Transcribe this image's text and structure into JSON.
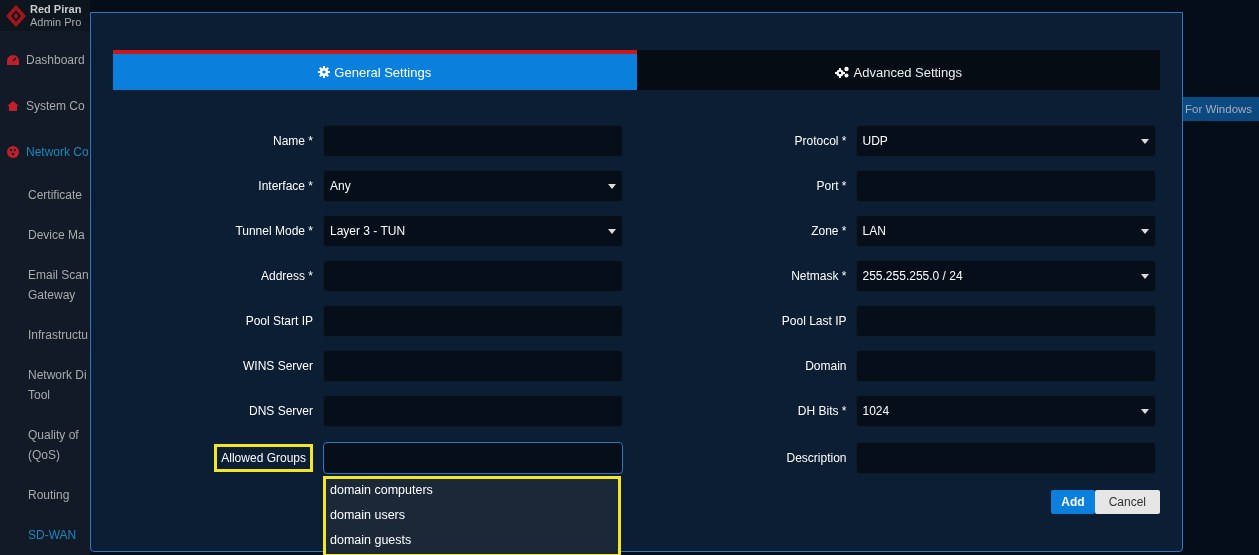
{
  "sidebar": {
    "brand": {
      "name": "Red Piran",
      "profile": "Admin Pro"
    },
    "items": [
      {
        "kind": "icon",
        "lines": [
          "Dashboard"
        ],
        "active": false
      },
      {
        "kind": "icon",
        "lines": [
          "System Co"
        ],
        "active": false
      },
      {
        "kind": "icon",
        "lines": [
          "Network Co"
        ],
        "active": true
      },
      {
        "kind": "sub",
        "lines": [
          "Certificate"
        ],
        "active": false
      },
      {
        "kind": "sub",
        "lines": [
          "Device Ma"
        ],
        "active": false
      },
      {
        "kind": "sub",
        "lines": [
          "Email Scan",
          "Gateway"
        ],
        "active": false
      },
      {
        "kind": "sub",
        "lines": [
          "Infrastructu"
        ],
        "active": false
      },
      {
        "kind": "sub",
        "lines": [
          "Network Di",
          "Tool"
        ],
        "active": false
      },
      {
        "kind": "sub",
        "lines": [
          "Quality of",
          "(QoS)"
        ],
        "active": false
      },
      {
        "kind": "sub",
        "lines": [
          "Routing"
        ],
        "active": false
      },
      {
        "kind": "sub",
        "lines": [
          "SD-WAN"
        ],
        "active": true
      }
    ]
  },
  "background_button": "For Windows",
  "modal": {
    "tabs": [
      {
        "label": "General Settings",
        "selected": true
      },
      {
        "label": "Advanced Settings",
        "selected": false
      }
    ],
    "left_fields": [
      {
        "label": "Name *",
        "kind": "text"
      },
      {
        "label": "Interface *",
        "kind": "select",
        "value": "Any"
      },
      {
        "label": "Tunnel Mode *",
        "kind": "select",
        "value": "Layer 3 - TUN"
      },
      {
        "label": "Address *",
        "kind": "text"
      },
      {
        "label": "Pool Start IP",
        "kind": "text"
      },
      {
        "label": "WINS Server",
        "kind": "text"
      },
      {
        "label": "DNS Server",
        "kind": "text"
      },
      {
        "label": "Allowed Groups",
        "kind": "multi",
        "highlighted": true,
        "focused": true,
        "options": [
          "domain computers",
          "domain users",
          "domain guests"
        ]
      }
    ],
    "right_fields": [
      {
        "label": "Protocol *",
        "kind": "select",
        "value": "UDP"
      },
      {
        "label": "Port *",
        "kind": "text"
      },
      {
        "label": "Zone *",
        "kind": "select",
        "value": "LAN"
      },
      {
        "label": "Netmask *",
        "kind": "select",
        "value": "255.255.255.0 / 24"
      },
      {
        "label": "Pool Last IP",
        "kind": "text"
      },
      {
        "label": "Domain",
        "kind": "text"
      },
      {
        "label": "DH Bits *",
        "kind": "select",
        "value": "1024"
      },
      {
        "label": "Description",
        "kind": "text"
      }
    ],
    "buttons": [
      {
        "label": "Add",
        "kind": "primary"
      },
      {
        "label": "Cancel",
        "kind": "secondary"
      }
    ]
  }
}
